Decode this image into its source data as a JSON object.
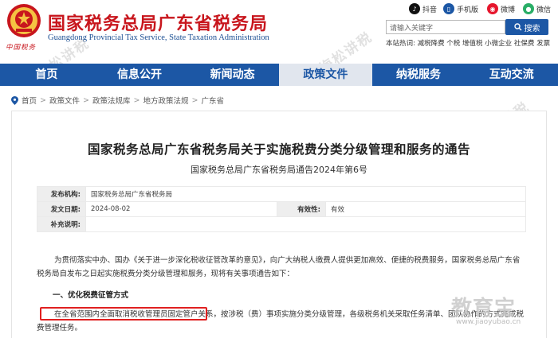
{
  "header": {
    "title": "国家税务总局广东省税务局",
    "title_en": "Guangdong Provincial Tax Service, State Taxation Administration",
    "emblem_caption": "中国税务",
    "social": [
      {
        "label": "抖音",
        "icon": "douyin-icon",
        "color": "#111111"
      },
      {
        "label": "手机版",
        "icon": "mobile-icon",
        "color": "#1c57a5"
      },
      {
        "label": "微博",
        "icon": "weibo-icon",
        "color": "#e6162d"
      },
      {
        "label": "微信",
        "icon": "wechat-icon",
        "color": "#2aae67"
      }
    ],
    "search_placeholder": "请输入关键字",
    "search_button": "搜索",
    "hotwords_label": "本站热词:",
    "hotwords": "减税降费 个税 增值税 小微企业 社保费 发票"
  },
  "nav": {
    "items": [
      {
        "label": "首页",
        "active": false
      },
      {
        "label": "信息公开",
        "active": false
      },
      {
        "label": "新闻动态",
        "active": false
      },
      {
        "label": "政策文件",
        "active": true
      },
      {
        "label": "纳税服务",
        "active": false
      },
      {
        "label": "互动交流",
        "active": false
      }
    ]
  },
  "breadcrumb": [
    "首页",
    "政策文件",
    "政策法规库",
    "地方政策法规",
    "广东省"
  ],
  "document": {
    "title": "国家税务总局广东省税务局关于实施税费分类分级管理和服务的通告",
    "number": "国家税务总局广东省税务局通告2024年第6号",
    "meta": {
      "issuer_label": "发布机构:",
      "issuer": "国家税务总局广东省税务局",
      "date_label": "发文日期:",
      "date": "2024-08-02",
      "validity_label": "有效性:",
      "validity": "有效",
      "note_label": "补充说明:",
      "note": ""
    },
    "intro": "为贯彻落实中办、国办《关于进一步深化税收征管改革的意见》，向广大纳税人缴费人提供更加高效、便捷的税费服务，国家税务总局广东省税务局自发布之日起实施税费分类分级管理和服务，现将有关事项通告如下：",
    "section1": "一、优化税费征管方式",
    "highlight_text": "在全省范围内全面取消税收管理员固定管户关系，",
    "para2_rest": "按涉税（费）事项实施分类分级管理，各级税务机关采取任务清单、团队协作的方式完成税费管理任务。"
  },
  "watermarks": {
    "text": "梅松讲税",
    "brand": "教育宝",
    "brand_url": "www.jiaoyubao.cn"
  }
}
